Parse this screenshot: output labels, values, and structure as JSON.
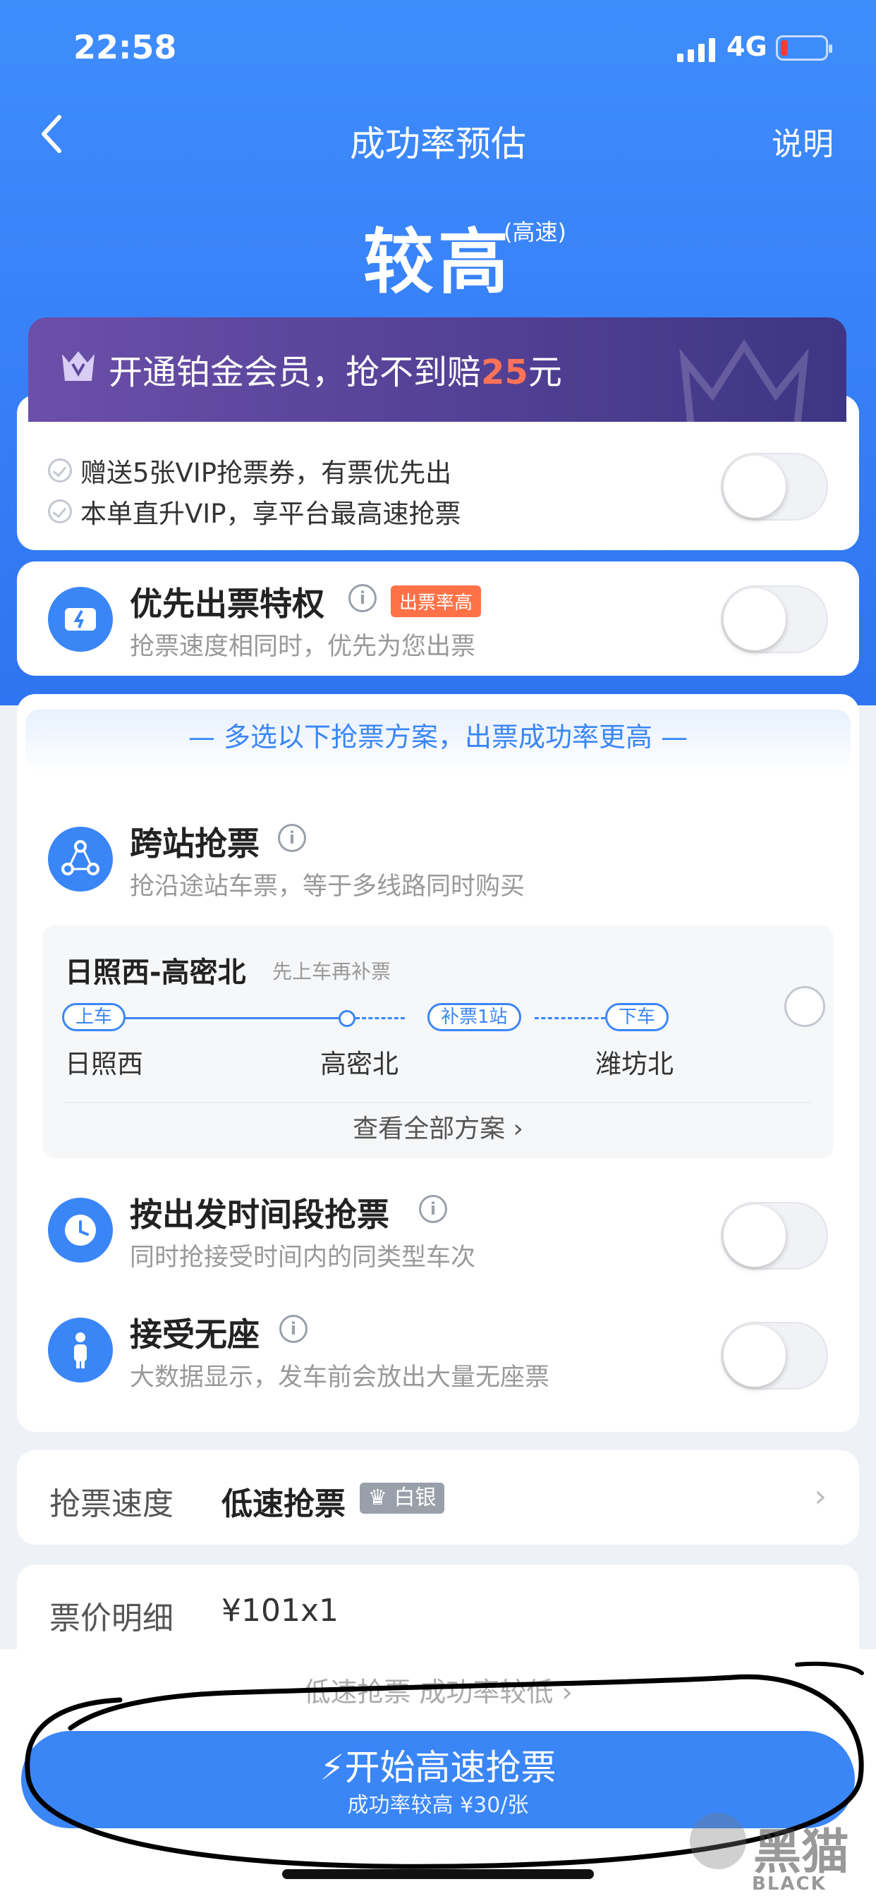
{
  "status": {
    "time": "22:58",
    "network": "4G"
  },
  "nav": {
    "title": "成功率预估",
    "help": "说明"
  },
  "rate": {
    "level": "较高",
    "mode": "(高速)"
  },
  "vip": {
    "banner_prefix": "开通铂金会员，抢不到赔",
    "banner_amount": "25",
    "banner_suffix": "元",
    "benefit1": "赠送5张VIP抢票券，有票优先出",
    "benefit2": "本单直升VIP，享平台最高速抢票"
  },
  "priority": {
    "title": "优先出票特权",
    "tag": "出票率高",
    "sub": "抢票速度相同时，优先为您出票"
  },
  "plans": {
    "banner": "— 多选以下抢票方案，出票成功率更高 —",
    "cross": {
      "title": "跨站抢票",
      "sub": "抢沿途站车票，等于多线路同时购买"
    },
    "route": {
      "name": "日照西-高密北",
      "hint": "先上车再补票",
      "board": "上车",
      "supp": "补票1站",
      "alight": "下车",
      "st1": "日照西",
      "st2": "高密北",
      "st3": "潍坊北",
      "view_all": "查看全部方案"
    },
    "timeslot": {
      "title": "按出发时间段抢票",
      "sub": "同时抢接受时间内的同类型车次"
    },
    "noseat": {
      "title": "接受无座",
      "sub": "大数据显示，发车前会放出大量无座票"
    }
  },
  "speed": {
    "label": "抢票速度",
    "value": "低速抢票",
    "badge": "白银"
  },
  "price": {
    "label": "票价明细",
    "value": "¥101x1"
  },
  "bottom": {
    "low": "低速抢票 成功率较低",
    "cta": "开始高速抢票",
    "cta_sub": "成功率较高 ¥30/张"
  },
  "watermark": {
    "cn": "黑猫",
    "en": "BLACK CAT"
  },
  "colors": {
    "accent": "#3a86f7",
    "vip": "#4a3d95",
    "alert": "#ff7147"
  }
}
